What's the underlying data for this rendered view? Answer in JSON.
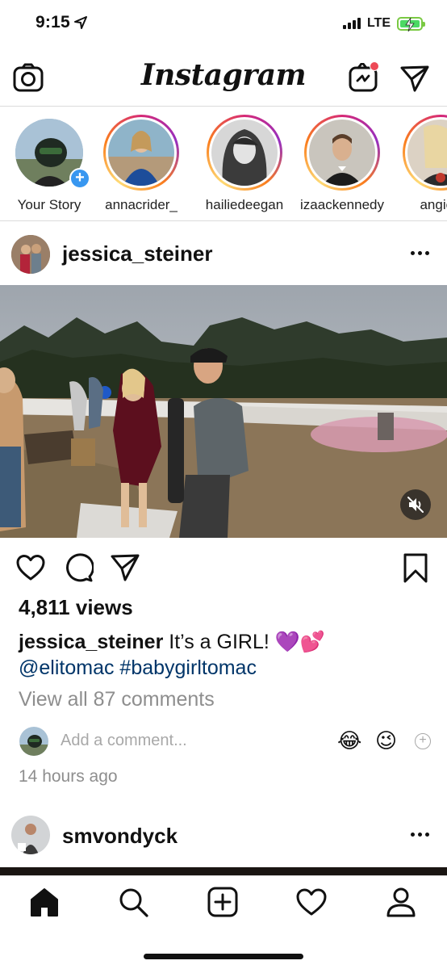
{
  "status_bar": {
    "time": "9:15",
    "network": "LTE"
  },
  "top_nav": {
    "logo": "Instagram"
  },
  "stories": [
    {
      "label": "Your Story"
    },
    {
      "label": "annacrider_"
    },
    {
      "label": "hailiedeegan"
    },
    {
      "label": "izaackennedy"
    },
    {
      "label": "angie_"
    }
  ],
  "post": {
    "username": "jessica_steiner",
    "views": "4,811 views",
    "caption_user": "jessica_steiner",
    "caption_text": " It’s a GIRL! 💜💕",
    "caption_mentions": "@elitomac #babygirltomac",
    "view_comments": "View all 87 comments",
    "add_comment_placeholder": "Add a comment...",
    "quick_emoji_1": "😂",
    "quick_emoji_2": "😉",
    "timestamp": "14 hours ago"
  },
  "next_post": {
    "username": "smvondyck"
  },
  "colors": {
    "link": "#003569",
    "story_ring": "#d62976",
    "notification": "#ed4956",
    "add_badge": "#3897f0"
  }
}
